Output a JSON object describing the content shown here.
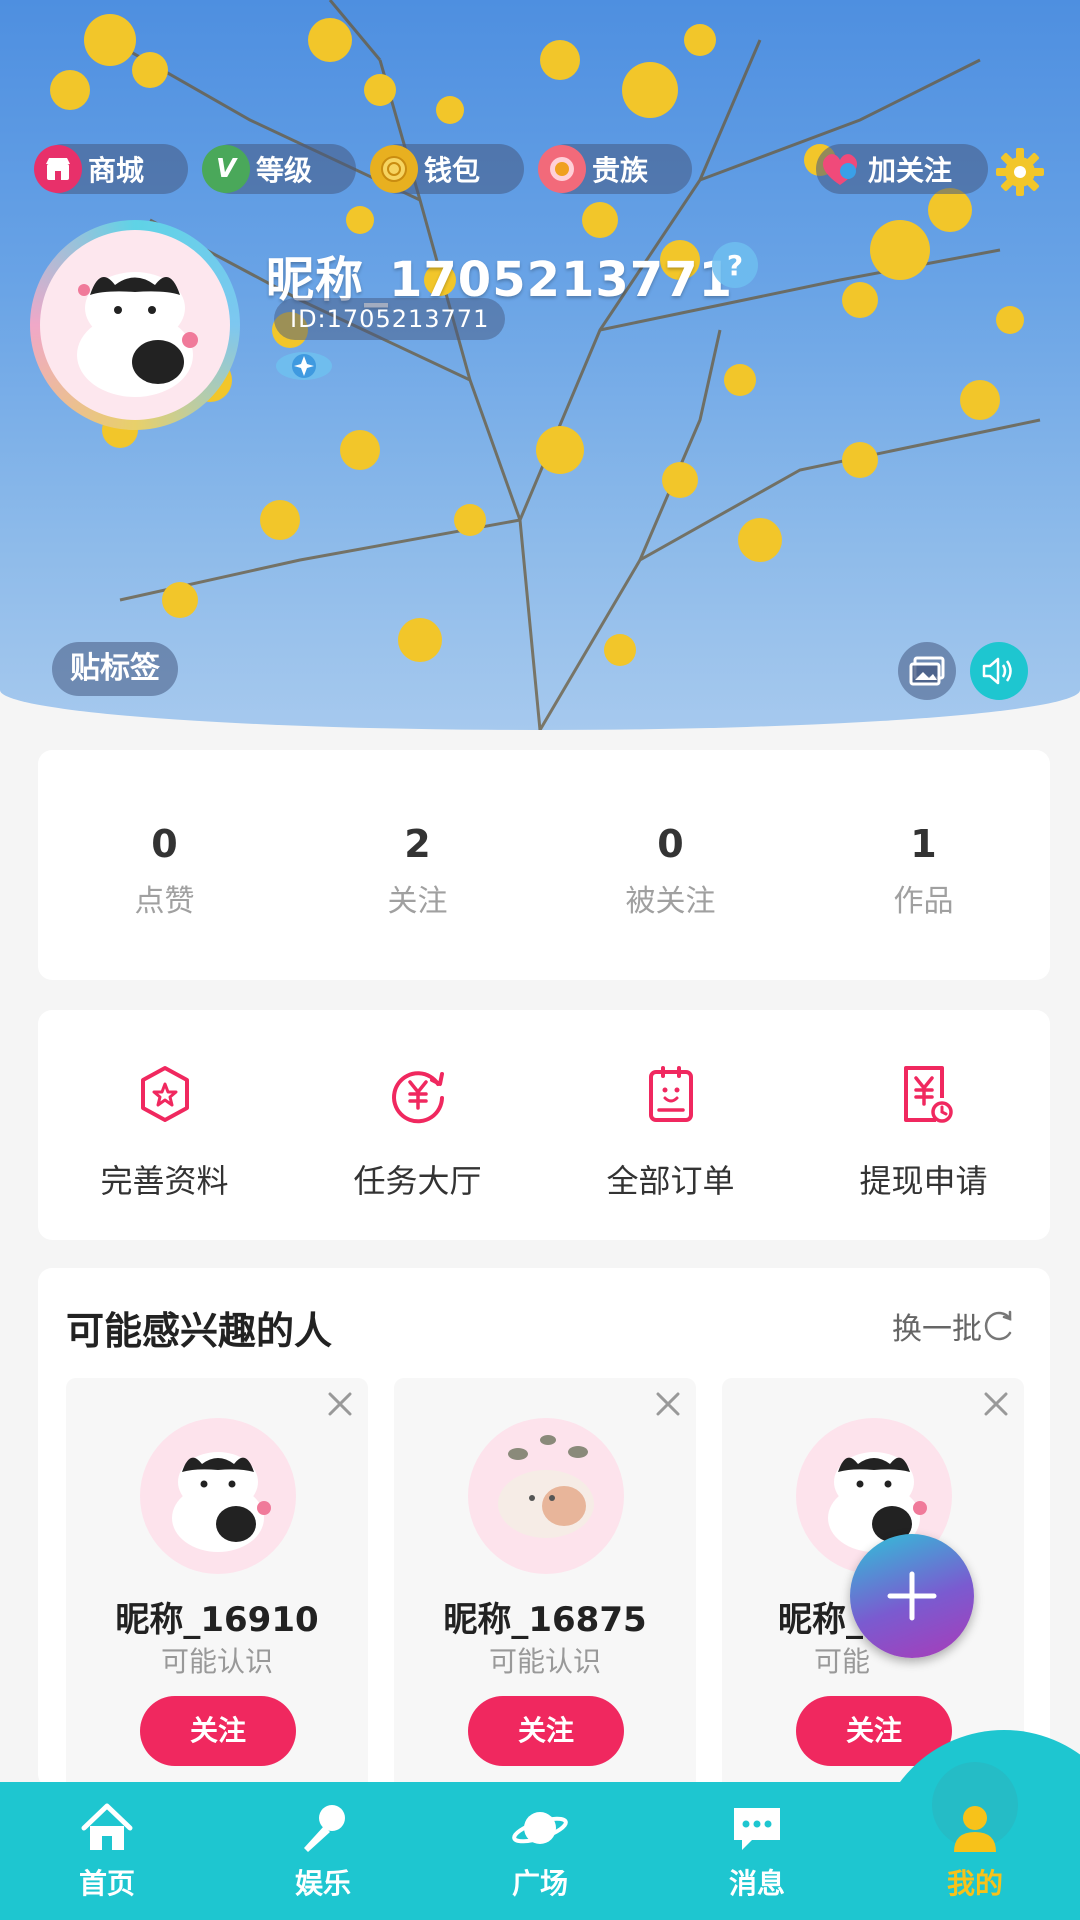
{
  "hero": {
    "pills": {
      "shop": "商城",
      "level": "等级",
      "level_glyph": "V",
      "wallet": "钱包",
      "noble": "贵族",
      "follow": "加关注"
    },
    "nickname": "昵称_1705213771",
    "help_glyph": "?",
    "user_id": "ID:1705213771",
    "tag_button": "贴标签"
  },
  "stats": [
    {
      "value": "0",
      "label": "点赞"
    },
    {
      "value": "2",
      "label": "关注"
    },
    {
      "value": "0",
      "label": "被关注"
    },
    {
      "value": "1",
      "label": "作品"
    }
  ],
  "actions": [
    {
      "label": "完善资料",
      "icon": "profile-star-icon"
    },
    {
      "label": "任务大厅",
      "icon": "yuan-refresh-icon"
    },
    {
      "label": "全部订单",
      "icon": "order-clipboard-icon"
    },
    {
      "label": "提现申请",
      "icon": "withdraw-bill-icon"
    }
  ],
  "recommend": {
    "title": "可能感兴趣的人",
    "refresh": "换一批",
    "people": [
      {
        "name": "昵称_16910",
        "sub": "可能认识",
        "follow": "关注"
      },
      {
        "name": "昵称_16875",
        "sub": "可能认识",
        "follow": "关注"
      },
      {
        "name": "昵称_",
        "sub": "可能",
        "follow": "关注"
      }
    ]
  },
  "tabbar": {
    "items": [
      {
        "label": "首页",
        "icon": "home-icon"
      },
      {
        "label": "娱乐",
        "icon": "microphone-icon"
      },
      {
        "label": "广场",
        "icon": "planet-icon"
      },
      {
        "label": "消息",
        "icon": "message-icon"
      },
      {
        "label": "我的",
        "icon": "user-icon"
      }
    ],
    "active": "我的"
  },
  "colors": {
    "accent": "#f0285f",
    "tabbar": "#1ec6d0",
    "active_tab": "#f7c21a"
  }
}
